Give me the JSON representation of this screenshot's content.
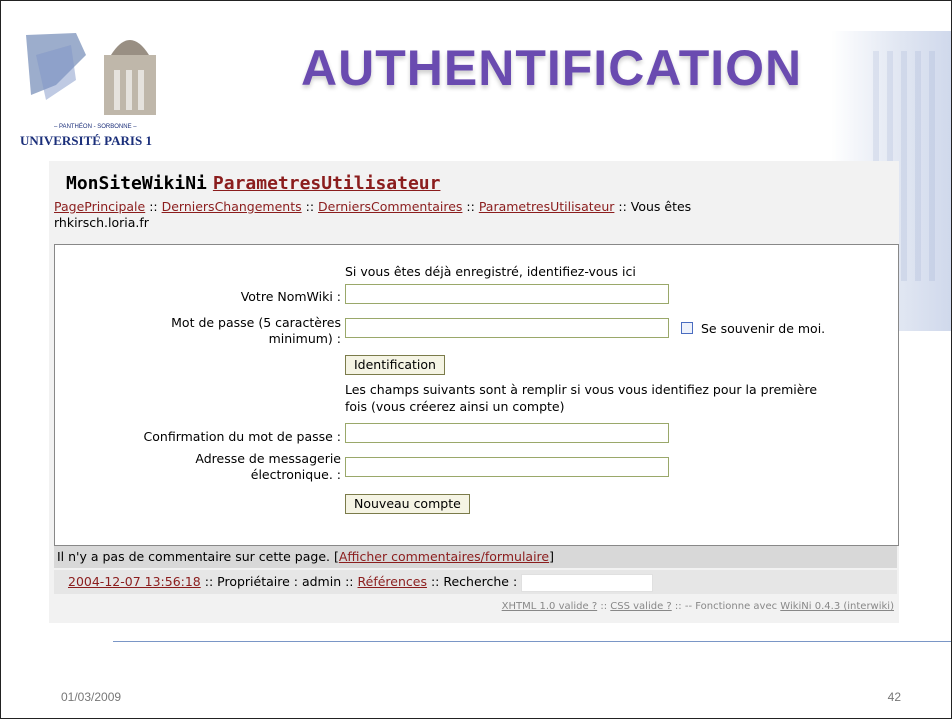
{
  "slide": {
    "title": "AUTHENTIFICATION",
    "date": "01/03/2009",
    "page_number": "42"
  },
  "logo": {
    "text_top": "– PANTHÉON - SORBONNE –",
    "text_bottom": "UNIVERSITÉ PARIS 1"
  },
  "wiki": {
    "site_name": "MonSiteWikiNi",
    "page_name": "ParametresUtilisateur",
    "nav": {
      "link1": "PagePrincipale",
      "link2": "DerniersChangements",
      "link3": "DerniersCommentaires",
      "link4": "ParametresUtilisateur",
      "sep": " :: ",
      "you_are": " :: Vous êtes",
      "host": "rhkirsch.loria.fr"
    },
    "form": {
      "intro": "Si vous êtes déjà enregistré, identifiez-vous ici",
      "nomwiki_label": "Votre NomWiki :",
      "password_label_l1": "Mot de passe (5 caractères",
      "password_label_l2": "minimum) :",
      "remember_label": "Se souvenir de moi.",
      "login_button": "Identification",
      "new_info_l1": "Les champs suivants sont à remplir si vous vous identifiez pour la première",
      "new_info_l2": "fois (vous créerez ainsi un compte)",
      "confirm_label": "Confirmation du mot de passe :",
      "email_label_l1": "Adresse de messagerie",
      "email_label_l2": "électronique. :",
      "new_account_button": "Nouveau compte"
    },
    "comments": {
      "text": "Il n'y a pas de commentaire sur cette page. [",
      "link": "Afficher commentaires/formulaire",
      "close": "]"
    },
    "footer": {
      "timestamp": "2004-12-07 13:56:18",
      "owner_text": " :: Propriétaire : admin :: ",
      "references": "Références",
      "search_text": " :: Recherche :"
    },
    "validity": {
      "xhtml": "XHTML 1.0 valide ?",
      "sep": " :: ",
      "css": "CSS valide ?",
      "powered": " :: -- Fonctionne avec ",
      "wikini": "WikiNi 0.4.3 (interwiki)"
    }
  }
}
